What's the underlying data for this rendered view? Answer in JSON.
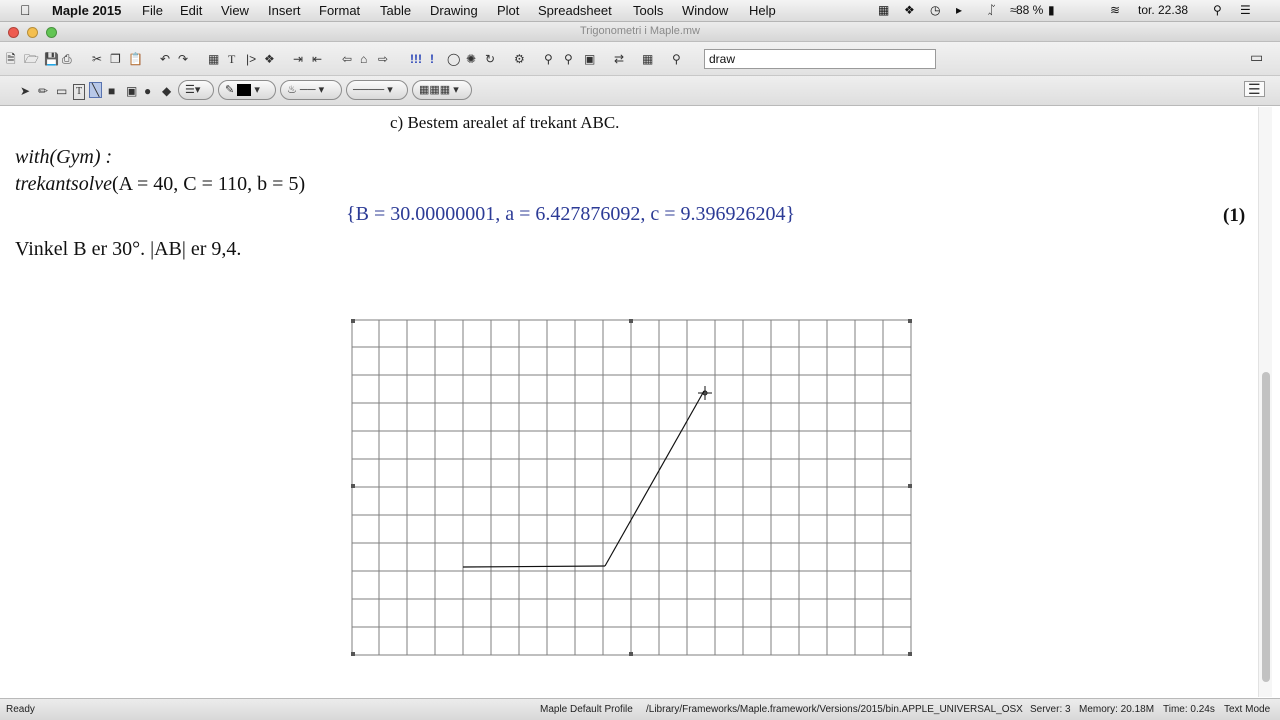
{
  "menubar": {
    "apple": "",
    "app_name": "Maple 2015",
    "items": [
      "File",
      "Edit",
      "View",
      "Insert",
      "Format",
      "Table",
      "Drawing",
      "Plot",
      "Spreadsheet",
      "Tools",
      "Window",
      "Help"
    ],
    "battery": "88 %",
    "clock": "tor. 22.38"
  },
  "window": {
    "title": "Trigonometri i Maple.mw"
  },
  "toolbar": {
    "search_value": "draw"
  },
  "document": {
    "question": "c)  Bestem arealet af trekant ABC.",
    "input_line1": "with(Gym) :",
    "input_line2_func": "trekantsolve",
    "input_line2_args": "(A = 40, C = 110, b = 5)",
    "output": "{B = 30.00000001, a = 6.427876092, c = 9.396926204}",
    "equation_label": "(1)",
    "paragraph": "Vinkel B er 30°. |AB| er 9,4."
  },
  "statusbar": {
    "ready": "Ready",
    "profile": "Maple Default Profile",
    "path": "/Library/Frameworks/Maple.framework/Versions/2015/bin.APPLE_UNIVERSAL_OSX",
    "server": "Server: 3",
    "memory": "Memory: 20.18M",
    "time": "Time: 0.24s",
    "mode": "Text Mode"
  },
  "colors": {
    "output_blue": "#2c3b96",
    "grid_line": "#7f7f7f",
    "stroke": "#111111"
  }
}
